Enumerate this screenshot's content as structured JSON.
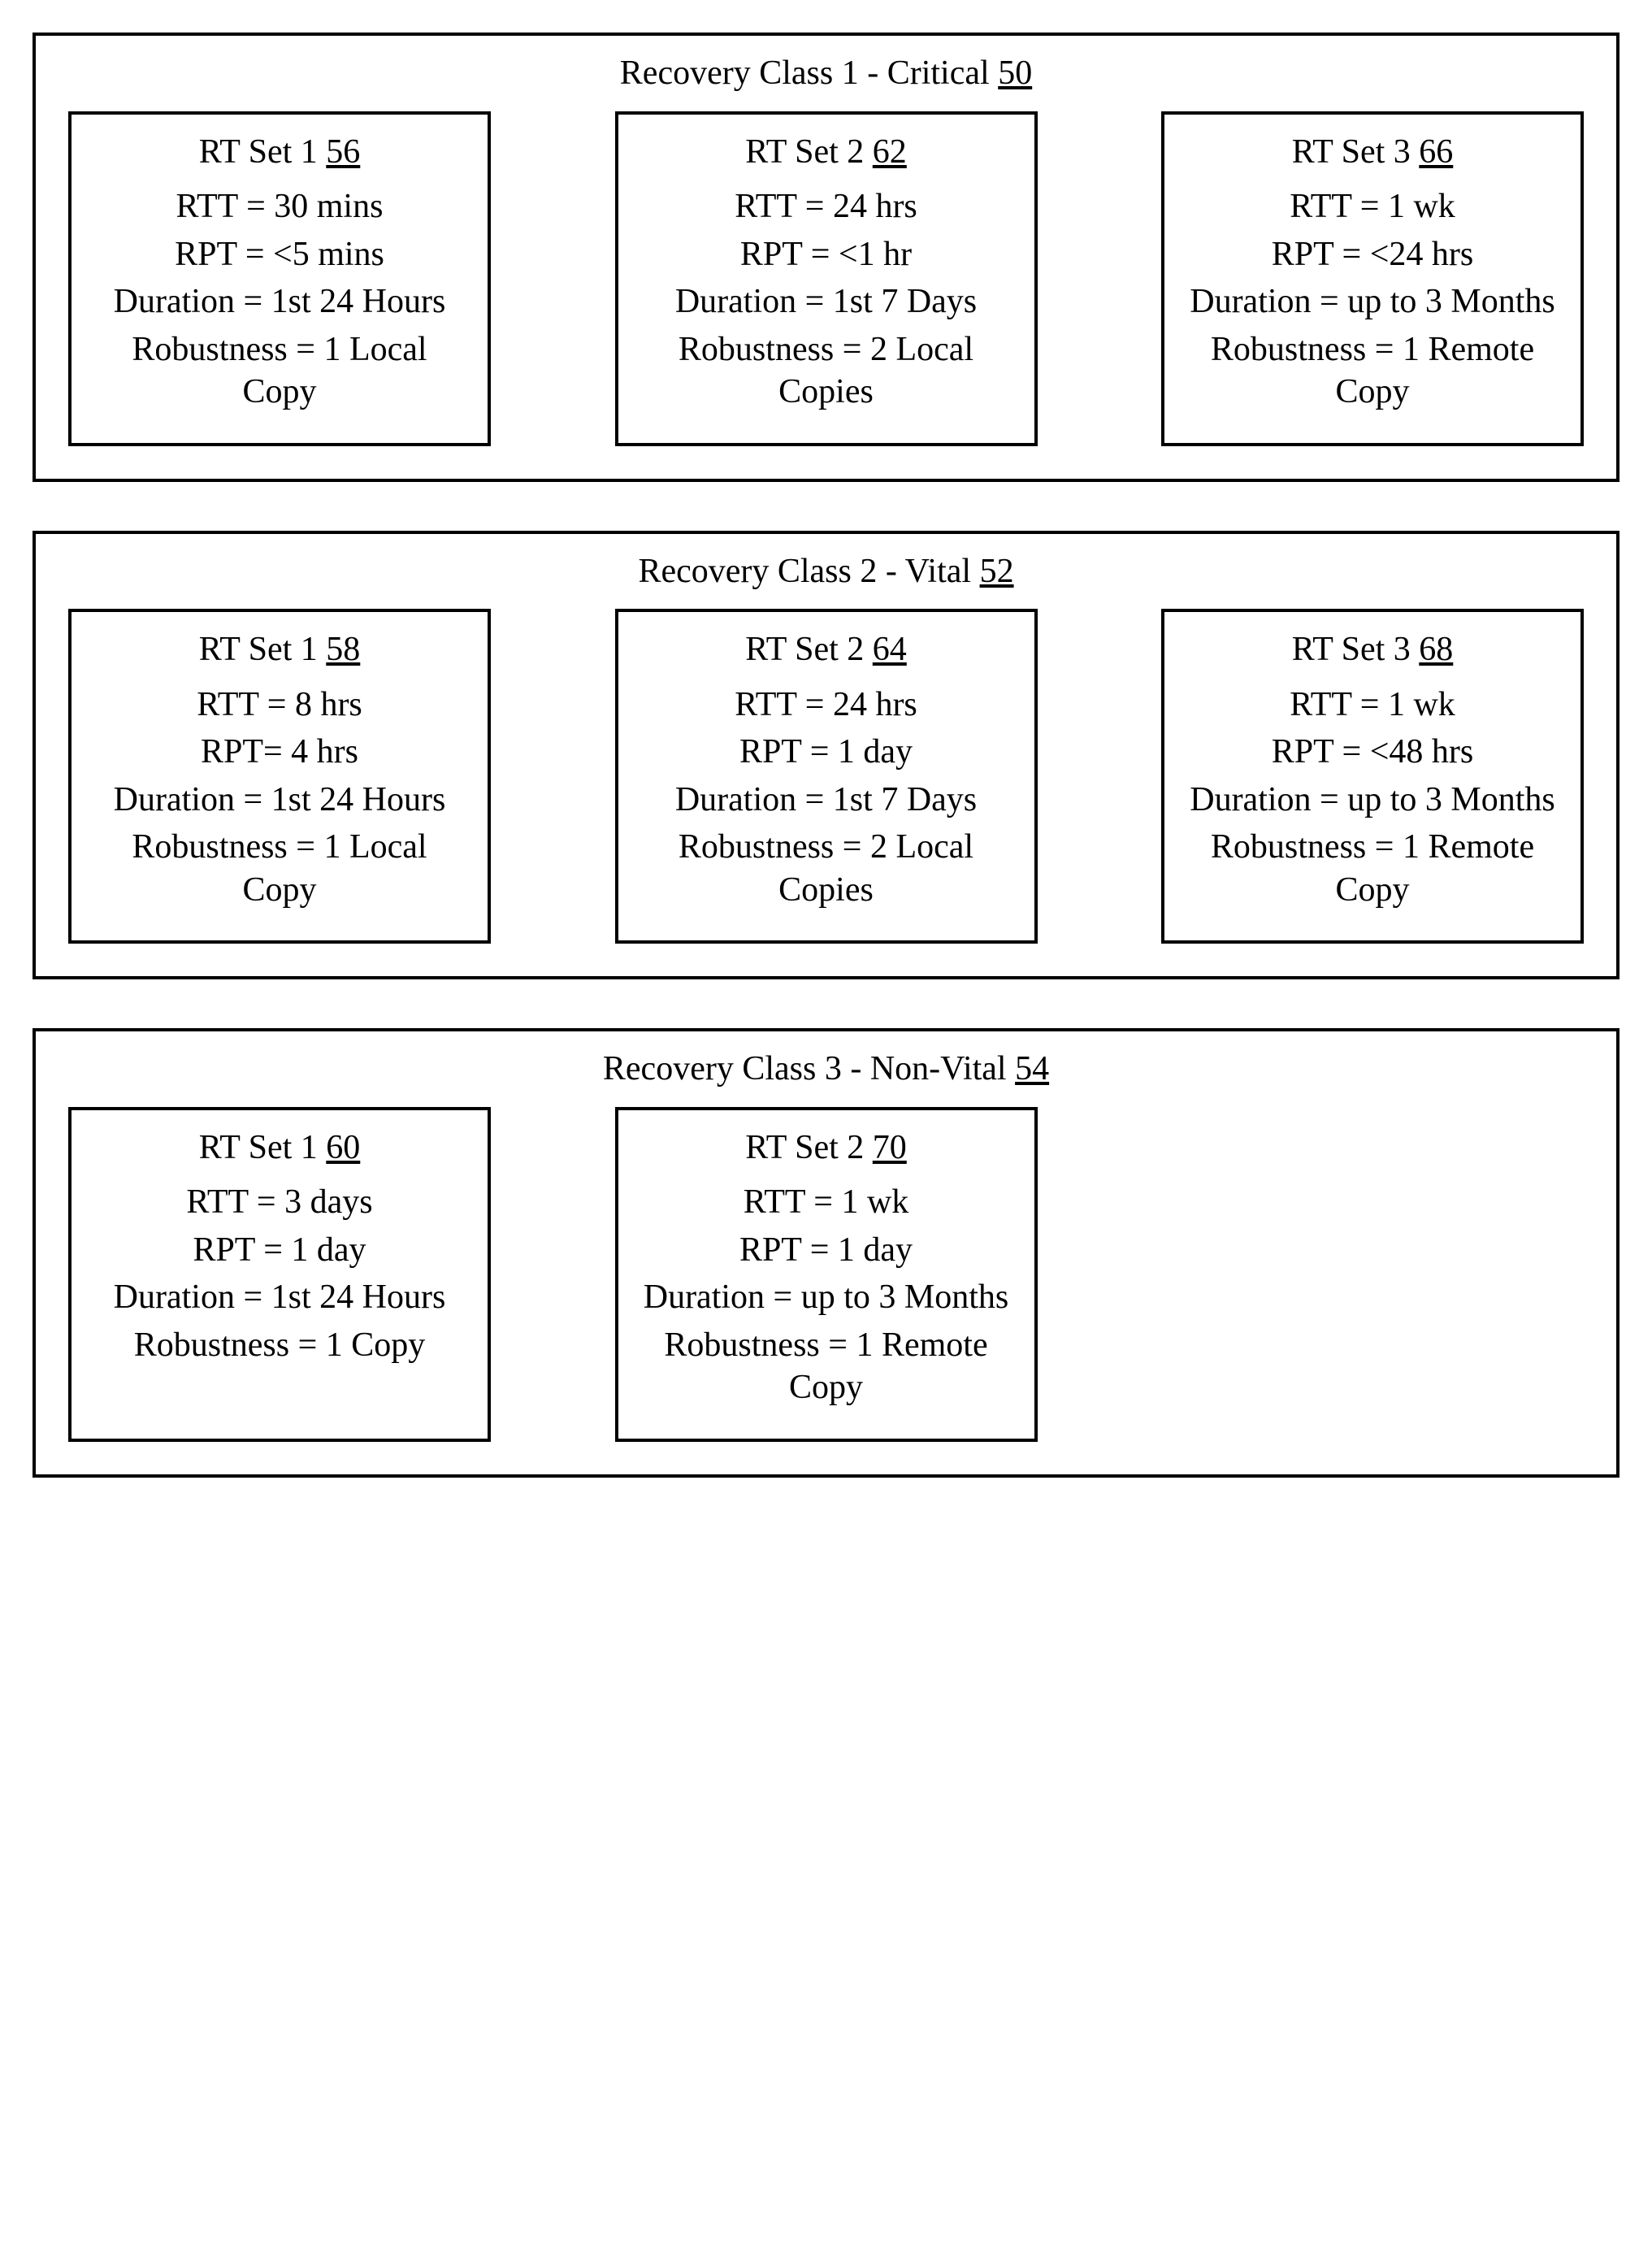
{
  "classes": [
    {
      "title_prefix": "Recovery Class 1 - Critical ",
      "ref": "50",
      "sets": [
        {
          "title_prefix": "RT Set 1 ",
          "ref": "56",
          "rtt": "RTT = 30 mins",
          "rpt": "RPT = <5 mins",
          "duration": "Duration = 1st 24 Hours",
          "robustness": "Robustness = 1 Local Copy"
        },
        {
          "title_prefix": "RT Set 2 ",
          "ref": "62",
          "rtt": "RTT = 24 hrs",
          "rpt": "RPT = <1 hr",
          "duration": "Duration = 1st 7 Days",
          "robustness": "Robustness = 2 Local Copies"
        },
        {
          "title_prefix": "RT Set 3 ",
          "ref": "66",
          "rtt": "RTT = 1 wk",
          "rpt": "RPT = <24 hrs",
          "duration": "Duration = up to 3 Months",
          "robustness": "Robustness = 1 Remote Copy"
        }
      ]
    },
    {
      "title_prefix": "Recovery Class 2 - Vital ",
      "ref": "52",
      "sets": [
        {
          "title_prefix": "RT Set 1 ",
          "ref": "58",
          "rtt": "RTT = 8 hrs",
          "rpt": "RPT= 4 hrs",
          "duration": "Duration = 1st 24 Hours",
          "robustness": "Robustness = 1 Local Copy"
        },
        {
          "title_prefix": "RT Set 2 ",
          "ref": "64",
          "rtt": "RTT = 24 hrs",
          "rpt": "RPT = 1 day",
          "duration": "Duration = 1st 7 Days",
          "robustness": "Robustness = 2 Local Copies"
        },
        {
          "title_prefix": "RT Set 3 ",
          "ref": "68",
          "rtt": "RTT = 1 wk",
          "rpt": "RPT = <48 hrs",
          "duration": "Duration = up to 3 Months",
          "robustness": "Robustness = 1 Remote Copy"
        }
      ]
    },
    {
      "title_prefix": "Recovery Class 3 - Non-Vital ",
      "ref": "54",
      "sets": [
        {
          "title_prefix": "RT Set 1 ",
          "ref": "60",
          "rtt": "RTT = 3 days",
          "rpt": "RPT = 1 day",
          "duration": "Duration = 1st 24 Hours",
          "robustness": "Robustness = 1 Copy"
        },
        {
          "title_prefix": "RT Set 2 ",
          "ref": "70",
          "rtt": "RTT = 1 wk",
          "rpt": "RPT = 1 day",
          "duration": "Duration = up to 3 Months",
          "robustness": "Robustness = 1 Remote Copy"
        }
      ]
    }
  ]
}
